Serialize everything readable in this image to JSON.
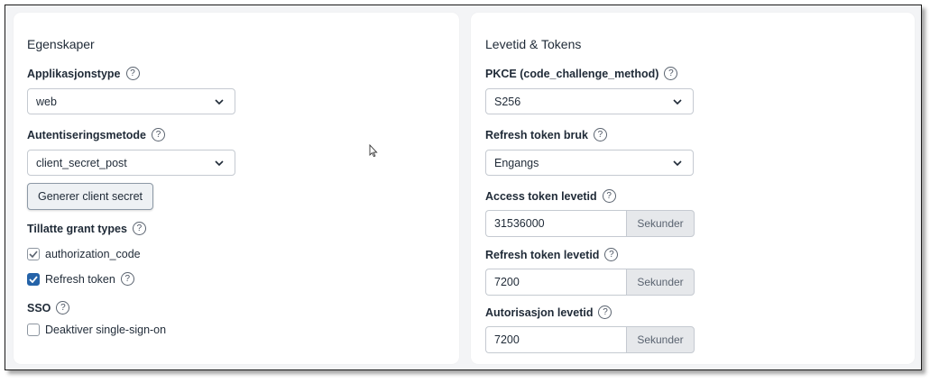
{
  "left": {
    "title": "Egenskaper",
    "app_type": {
      "label": "Applikasjonstype",
      "help": "?",
      "value": "web"
    },
    "auth_method": {
      "label": "Autentiseringsmetode",
      "help": "?",
      "value": "client_secret_post"
    },
    "generate_button": "Generer client secret",
    "grant_types": {
      "label": "Tillatte grant types",
      "help": "?",
      "items": [
        {
          "label": "authorization_code",
          "checked": true
        },
        {
          "label": "Refresh token",
          "checked": true,
          "help": "?"
        }
      ]
    },
    "sso": {
      "label": "SSO",
      "help": "?",
      "option": {
        "label": "Deaktiver single-sign-on",
        "checked": false
      }
    }
  },
  "right": {
    "title": "Levetid & Tokens",
    "pkce": {
      "label": "PKCE (code_challenge_method)",
      "help": "?",
      "value": "S256"
    },
    "refresh_usage": {
      "label": "Refresh token bruk",
      "help": "?",
      "value": "Engangs"
    },
    "access_lifetime": {
      "label": "Access token levetid",
      "help": "?",
      "value": "31536000",
      "unit": "Sekunder"
    },
    "refresh_lifetime": {
      "label": "Refresh token levetid",
      "help": "?",
      "value": "7200",
      "unit": "Sekunder"
    },
    "auth_lifetime": {
      "label": "Autorisasjon levetid",
      "help": "?",
      "value": "7200",
      "unit": "Sekunder"
    }
  },
  "colors": {
    "accent": "#2563a8",
    "card_bg": "#ffffff",
    "page_bg": "#f3f4f6"
  }
}
